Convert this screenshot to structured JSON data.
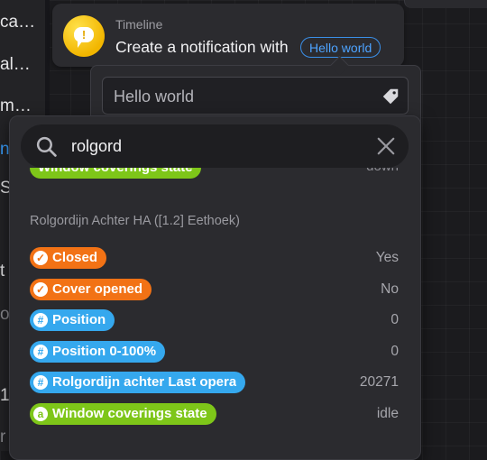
{
  "sidebar": {
    "items": [
      {
        "label": "ca…",
        "style": "normal"
      },
      {
        "label": "al…",
        "style": "normal"
      },
      {
        "label": "m…",
        "style": "normal"
      },
      {
        "label": "n",
        "style": "blue"
      },
      {
        "label": "S",
        "style": "normal"
      },
      {
        "label": "t",
        "style": "normal"
      },
      {
        "label": "o",
        "style": "dim"
      },
      {
        "label": "1",
        "style": "normal"
      },
      {
        "label": "r",
        "style": "dim"
      }
    ]
  },
  "timeline_card": {
    "label": "Timeline",
    "title": "Create a notification with",
    "token": "Hello world",
    "icon": "alert-bubble-icon",
    "icon_color": "#f5c400"
  },
  "editor": {
    "value": "Hello world",
    "tag_icon": "tag-icon"
  },
  "search": {
    "query": "rolgord",
    "clear_icon": "close-icon"
  },
  "partial_row": {
    "label": "Window coverings state",
    "value": "down"
  },
  "device_heading": "Rolgordijn Achter HA ([1.2] Eethoek)",
  "capabilities": [
    {
      "label": "Closed",
      "value": "Yes",
      "type": "boolean",
      "color": "#f27215"
    },
    {
      "label": "Cover opened",
      "value": "No",
      "type": "boolean",
      "color": "#f27215"
    },
    {
      "label": "Position",
      "value": "0",
      "type": "number",
      "color": "#35a8ee"
    },
    {
      "label": "Position 0-100%",
      "value": "0",
      "type": "number",
      "color": "#35a8ee"
    },
    {
      "label": "Rolgordijn achter Last opera",
      "value": "20271",
      "type": "number",
      "color": "#35a8ee"
    },
    {
      "label": "Window coverings state",
      "value": "idle",
      "type": "string",
      "color": "#7ec619"
    }
  ]
}
